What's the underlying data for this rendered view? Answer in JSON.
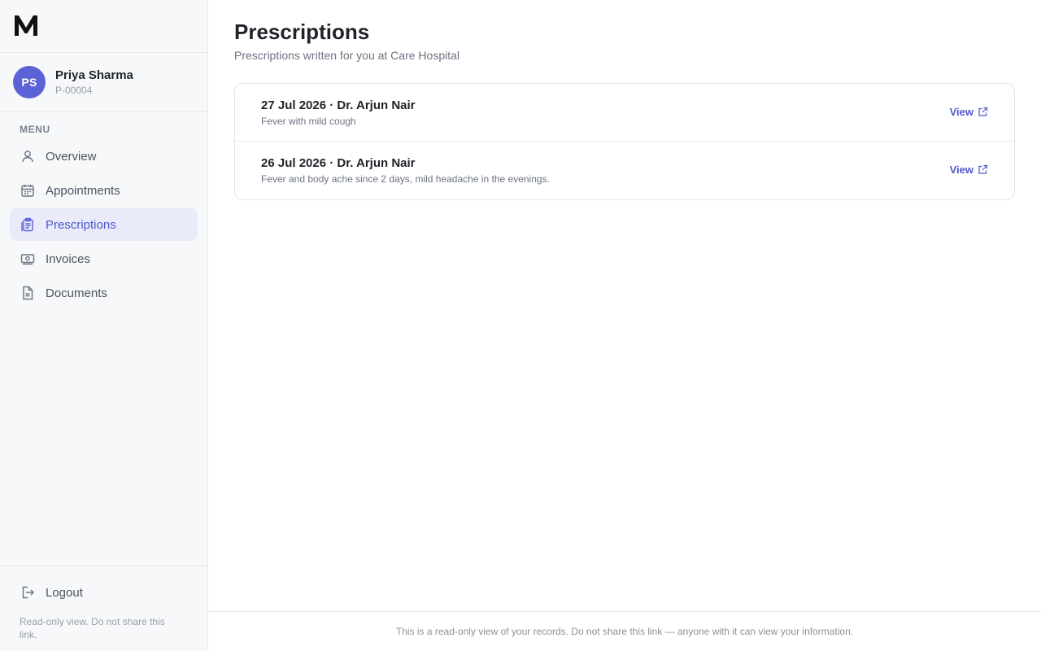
{
  "sidebar": {
    "logo_alt": "M",
    "profile": {
      "initials": "PS",
      "name": "Priya Sharma",
      "patient_id": "P-00004"
    },
    "menu_label": "MENU",
    "items": [
      {
        "label": "Overview",
        "icon": "user-icon"
      },
      {
        "label": "Appointments",
        "icon": "calendar-icon"
      },
      {
        "label": "Prescriptions",
        "icon": "clipboard-icon",
        "active": true
      },
      {
        "label": "Invoices",
        "icon": "money-icon"
      },
      {
        "label": "Documents",
        "icon": "document-icon"
      }
    ],
    "logout_label": "Logout",
    "note": "Read-only view. Do not share this link."
  },
  "main": {
    "title": "Prescriptions",
    "subtitle": "Prescriptions written for you at Care Hospital",
    "prescriptions": [
      {
        "title": "27 Jul 2026 · Dr. Arjun Nair",
        "description": "Fever with mild cough",
        "action": "View"
      },
      {
        "title": "26 Jul 2026 · Dr. Arjun Nair",
        "description": "Fever and body ache since 2 days, mild headache in the evenings.",
        "action": "View"
      }
    ]
  },
  "footer": {
    "text": "This is a read-only view of your records. Do not share this link — anyone with it can view your information."
  },
  "colors": {
    "accent": "#5b62d6",
    "active_bg": "#e9ebfb",
    "sidebar_bg": "#f7f8fa"
  }
}
